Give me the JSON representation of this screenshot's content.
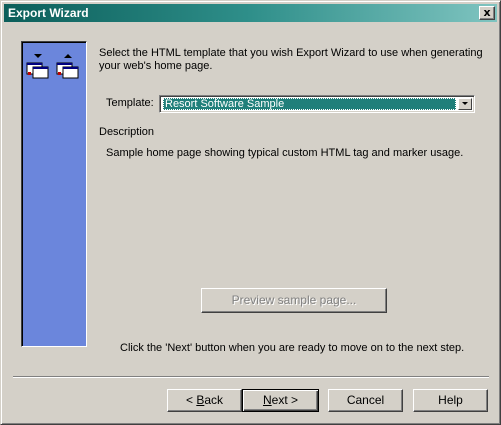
{
  "window": {
    "title": "Export Wizard",
    "close_glyph": "x",
    "title_colors": {
      "start": "#0b5e5a",
      "end": "#7fc4c0"
    }
  },
  "side_panel": {
    "color": "#6b86dc",
    "icons": [
      "page-arrow-down-icon",
      "page-arrow-up-icon"
    ]
  },
  "instructions": {
    "line1": "Select the HTML template that you wish Export Wizard to use when generating",
    "line2": "your web's home page."
  },
  "template": {
    "label": "Template:",
    "selected": "Resort Software Sample"
  },
  "description": {
    "heading": "Description",
    "text": "Sample home page showing typical custom HTML tag and marker usage."
  },
  "preview_button": {
    "label": "Preview sample page...",
    "enabled": false
  },
  "next_hint": "Click the 'Next' button when you are ready to move on to the next step.",
  "buttons": {
    "back_prefix": "< ",
    "back_mnemonic": "B",
    "back_rest": "ack",
    "next_mnemonic": "N",
    "next_rest": "ext >",
    "cancel": "Cancel",
    "help": "Help"
  }
}
